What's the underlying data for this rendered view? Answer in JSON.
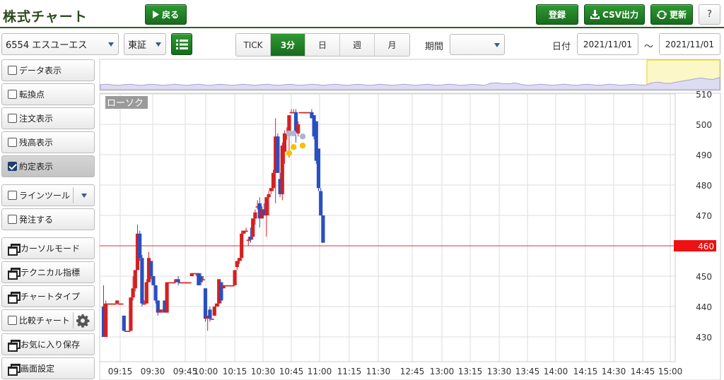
{
  "header": {
    "title": "株式チャート",
    "back_label": "戻る",
    "register_label": "登録",
    "csv_label": "CSV出力",
    "refresh_label": "更新",
    "help_label": "?"
  },
  "toolbar": {
    "stock": "6554 エスユーエス",
    "market": "東証",
    "intervals": [
      "TICK",
      "3分",
      "日",
      "週",
      "月"
    ],
    "active_interval": "3分",
    "period_label": "期間",
    "period_value": "",
    "date_label": "日付",
    "date_from": "2021/11/01",
    "date_sep": "～",
    "date_to": "2021/11/01"
  },
  "sidebar": {
    "items": [
      {
        "label": "データ表示",
        "kind": "checkbox",
        "checked": false
      },
      {
        "label": "転換点",
        "kind": "checkbox",
        "checked": false
      },
      {
        "label": "注文表示",
        "kind": "checkbox",
        "checked": false
      },
      {
        "label": "残高表示",
        "kind": "checkbox",
        "checked": false
      },
      {
        "label": "約定表示",
        "kind": "checkbox",
        "checked": true
      },
      {
        "label": "ラインツール",
        "kind": "checkbox-dropdown",
        "checked": false
      },
      {
        "label": "発注する",
        "kind": "checkbox",
        "checked": false
      },
      {
        "label": "カーソルモード",
        "kind": "window"
      },
      {
        "label": "テクニカル指標",
        "kind": "window"
      },
      {
        "label": "チャートタイプ",
        "kind": "window"
      },
      {
        "label": "比較チャート",
        "kind": "checkbox-gear",
        "checked": false
      },
      {
        "label": "お気に入り保存",
        "kind": "window"
      },
      {
        "label": "画面設定",
        "kind": "window"
      }
    ]
  },
  "chart_data": {
    "type": "candlestick",
    "tag": "ローソク",
    "ylim": [
      425,
      512
    ],
    "yticks": [
      430,
      440,
      450,
      460,
      470,
      480,
      490,
      500,
      510
    ],
    "xticks": [
      "09:15",
      "09:30",
      "09:45",
      "10:00",
      "10:15",
      "10:30",
      "10:45",
      "11:00",
      "11:15",
      "11:30",
      "12:45",
      "13:00",
      "13:15",
      "13:30",
      "13:45",
      "14:00",
      "14:15",
      "14:30",
      "14:45",
      "15:00"
    ],
    "current_price": 460,
    "colors": {
      "up": "#d42020",
      "down": "#2a4fc0",
      "flat": "#d42020",
      "price_line": "#e03030",
      "price_badge": "#ee1111",
      "buy_marker": "#f2c200",
      "sell_marker": "#a9b6d4"
    },
    "candles": [
      {
        "o": 440,
        "h": 447,
        "l": 430,
        "c": 430
      },
      {
        "o": 430,
        "h": 442,
        "l": 430,
        "c": 441
      },
      {
        "o": 441,
        "h": 441,
        "l": 441,
        "c": 441
      },
      {
        "o": 441,
        "h": 441,
        "l": 441,
        "c": 441
      },
      {
        "o": 441,
        "h": 441,
        "l": 441,
        "c": 441
      },
      {
        "o": 441,
        "h": 441,
        "l": 441,
        "c": 441
      },
      {
        "o": 441,
        "h": 442,
        "l": 441,
        "c": 442
      },
      {
        "o": 441,
        "h": 441,
        "l": 441,
        "c": 441
      },
      {
        "o": 441,
        "h": 441,
        "l": 441,
        "c": 441
      },
      {
        "o": 437,
        "h": 437,
        "l": 432,
        "c": 432
      },
      {
        "o": 432,
        "h": 432,
        "l": 432,
        "c": 432
      },
      {
        "o": 432,
        "h": 432,
        "l": 432,
        "c": 432
      },
      {
        "o": 432,
        "h": 443,
        "l": 432,
        "c": 443
      },
      {
        "o": 443,
        "h": 450,
        "l": 442,
        "c": 446
      },
      {
        "o": 446,
        "h": 452,
        "l": 445,
        "c": 452
      },
      {
        "o": 452,
        "h": 467,
        "l": 452,
        "c": 464
      },
      {
        "o": 464,
        "h": 465,
        "l": 455,
        "c": 456
      },
      {
        "o": 456,
        "h": 457,
        "l": 440,
        "c": 441
      },
      {
        "o": 441,
        "h": 442,
        "l": 441,
        "c": 441
      },
      {
        "o": 441,
        "h": 449,
        "l": 441,
        "c": 448
      },
      {
        "o": 448,
        "h": 458,
        "l": 448,
        "c": 456
      },
      {
        "o": 455,
        "h": 455,
        "l": 449,
        "c": 450
      },
      {
        "o": 450,
        "h": 450,
        "l": 447,
        "c": 447
      },
      {
        "o": 447,
        "h": 447,
        "l": 441,
        "c": 442
      },
      {
        "o": 442,
        "h": 442,
        "l": 437,
        "c": 438
      },
      {
        "o": 438,
        "h": 439,
        "l": 438,
        "c": 439
      },
      {
        "o": 439,
        "h": 439,
        "l": 438,
        "c": 439
      },
      {
        "o": 442,
        "h": 442,
        "l": 438,
        "c": 438
      },
      {
        "o": 438,
        "h": 448,
        "l": 438,
        "c": 448
      },
      {
        "o": 448,
        "h": 448,
        "l": 448,
        "c": 448
      },
      {
        "o": 448,
        "h": 448,
        "l": 448,
        "c": 448
      },
      {
        "o": 448,
        "h": 448,
        "l": 448,
        "c": 448
      },
      {
        "o": 448,
        "h": 449,
        "l": 448,
        "c": 449
      },
      {
        "o": 449,
        "h": 450,
        "l": 447,
        "c": 448
      },
      {
        "o": 448,
        "h": 448,
        "l": 448,
        "c": 448
      },
      {
        "o": 448,
        "h": 448,
        "l": 448,
        "c": 448
      },
      {
        "o": 448,
        "h": 448,
        "l": 448,
        "c": 448
      },
      {
        "o": 448,
        "h": 448,
        "l": 448,
        "c": 448
      },
      {
        "o": 448,
        "h": 448,
        "l": 448,
        "c": 448
      },
      {
        "o": 450,
        "h": 451,
        "l": 450,
        "c": 451
      },
      {
        "o": 451,
        "h": 451,
        "l": 451,
        "c": 451
      },
      {
        "o": 451,
        "h": 451,
        "l": 450,
        "c": 451
      },
      {
        "o": 451,
        "h": 451,
        "l": 447,
        "c": 447
      },
      {
        "o": 450,
        "h": 451,
        "l": 447,
        "c": 448
      },
      {
        "o": 449,
        "h": 450,
        "l": 449,
        "c": 449
      },
      {
        "o": 446,
        "h": 446,
        "l": 435,
        "c": 436
      },
      {
        "o": 436,
        "h": 436,
        "l": 432,
        "c": 437
      },
      {
        "o": 439,
        "h": 440,
        "l": 435,
        "c": 436
      },
      {
        "o": 436,
        "h": 436,
        "l": 436,
        "c": 436
      },
      {
        "o": 437,
        "h": 440,
        "l": 437,
        "c": 440
      },
      {
        "o": 440,
        "h": 441,
        "l": 440,
        "c": 441
      },
      {
        "o": 441,
        "h": 449,
        "l": 440,
        "c": 449
      },
      {
        "o": 448,
        "h": 448,
        "l": 441,
        "c": 442
      },
      {
        "o": 446,
        "h": 447,
        "l": 446,
        "c": 447
      },
      {
        "o": 447,
        "h": 447,
        "l": 447,
        "c": 447
      },
      {
        "o": 447,
        "h": 447,
        "l": 447,
        "c": 447
      },
      {
        "o": 447,
        "h": 447,
        "l": 447,
        "c": 447
      },
      {
        "o": 447,
        "h": 447,
        "l": 447,
        "c": 447
      },
      {
        "o": 447,
        "h": 452,
        "l": 447,
        "c": 452
      },
      {
        "o": 453,
        "h": 455,
        "l": 452,
        "c": 455
      },
      {
        "o": 455,
        "h": 456,
        "l": 454,
        "c": 456
      },
      {
        "o": 456,
        "h": 465,
        "l": 455,
        "c": 464
      },
      {
        "o": 464,
        "h": 465,
        "l": 464,
        "c": 465
      },
      {
        "o": 465,
        "h": 466,
        "l": 465,
        "c": 465
      },
      {
        "o": 462,
        "h": 463,
        "l": 460,
        "c": 462
      },
      {
        "o": 463,
        "h": 466,
        "l": 461,
        "c": 462
      },
      {
        "o": 463,
        "h": 469,
        "l": 462,
        "c": 469
      },
      {
        "o": 469,
        "h": 472,
        "l": 467,
        "c": 471
      },
      {
        "o": 473,
        "h": 475,
        "l": 472,
        "c": 473
      },
      {
        "o": 474,
        "h": 476,
        "l": 466,
        "c": 469
      },
      {
        "o": 469,
        "h": 473,
        "l": 469,
        "c": 472
      },
      {
        "o": 472,
        "h": 474,
        "l": 470,
        "c": 470
      },
      {
        "o": 470,
        "h": 476,
        "l": 463,
        "c": 476
      },
      {
        "o": 476,
        "h": 478,
        "l": 470,
        "c": 477
      },
      {
        "o": 478,
        "h": 479,
        "l": 477,
        "c": 479
      },
      {
        "o": 479,
        "h": 485,
        "l": 478,
        "c": 484
      },
      {
        "o": 484,
        "h": 502,
        "l": 474,
        "c": 496
      },
      {
        "o": 496,
        "h": 497,
        "l": 484,
        "c": 484
      },
      {
        "o": 482,
        "h": 484,
        "l": 476,
        "c": 477
      },
      {
        "o": 477,
        "h": 494,
        "l": 475,
        "c": 493
      },
      {
        "o": 491,
        "h": 498,
        "l": 487,
        "c": 497
      },
      {
        "o": 497,
        "h": 499,
        "l": 495,
        "c": 497
      },
      {
        "o": 497,
        "h": 503,
        "l": 489,
        "c": 503
      },
      {
        "o": 504,
        "h": 505,
        "l": 504,
        "c": 504
      },
      {
        "o": 504,
        "h": 505,
        "l": 504,
        "c": 504
      },
      {
        "o": 504,
        "h": 505,
        "l": 494,
        "c": 497
      },
      {
        "o": 497,
        "h": 501,
        "l": 496,
        "c": 500
      },
      {
        "o": 504,
        "h": 504,
        "l": 504,
        "c": 504
      },
      {
        "o": 504,
        "h": 504,
        "l": 504,
        "c": 504
      },
      {
        "o": 504,
        "h": 504,
        "l": 504,
        "c": 504
      },
      {
        "o": 504,
        "h": 504,
        "l": 504,
        "c": 504
      },
      {
        "o": 504,
        "h": 504,
        "l": 504,
        "c": 504
      },
      {
        "o": 504,
        "h": 505,
        "l": 502,
        "c": 502
      },
      {
        "o": 503,
        "h": 503,
        "l": 495,
        "c": 496
      },
      {
        "o": 501,
        "h": 501,
        "l": 487,
        "c": 488
      },
      {
        "o": 492,
        "h": 492,
        "l": 478,
        "c": 479
      },
      {
        "o": 478,
        "h": 479,
        "l": 470,
        "c": 470
      },
      {
        "o": 470,
        "h": 470,
        "l": 461,
        "c": 461
      }
    ],
    "trade_markers": [
      {
        "i": 82,
        "price": 490.5,
        "side": "buy"
      },
      {
        "i": 84,
        "price": 492.5,
        "side": "buy"
      },
      {
        "i": 88,
        "price": 493,
        "side": "buy"
      },
      {
        "i": 82,
        "price": 497,
        "side": "sell"
      },
      {
        "i": 84,
        "price": 497,
        "side": "sell"
      },
      {
        "i": 88,
        "price": 496,
        "side": "sell"
      }
    ]
  }
}
